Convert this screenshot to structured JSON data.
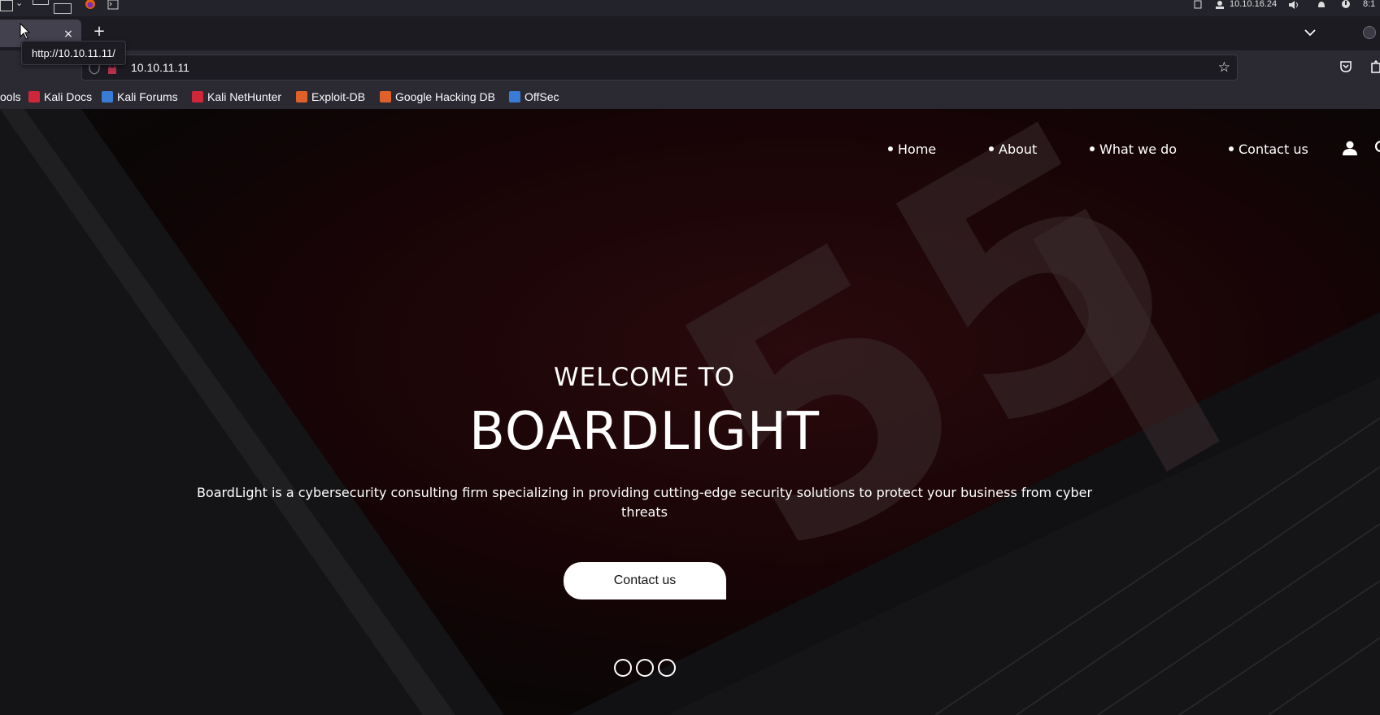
{
  "os": {
    "ip": "10.10.16.24",
    "clock": "8:1"
  },
  "browser": {
    "new_tab_label": "+",
    "tab_close_label": "×",
    "url": "10.10.11.11",
    "hover_url": "http://10.10.11.11/",
    "bookmark_star": "☆"
  },
  "bookmarks": [
    {
      "label": "ools",
      "color": "#2b2a33"
    },
    {
      "label": "Kali Docs",
      "color": "#d0263a"
    },
    {
      "label": "Kali Forums",
      "color": "#3a7bd5"
    },
    {
      "label": "Kali NetHunter",
      "color": "#d0263a"
    },
    {
      "label": "Exploit-DB",
      "color": "#e0602a"
    },
    {
      "label": "Google Hacking DB",
      "color": "#e0602a"
    },
    {
      "label": "OffSec",
      "color": "#3a7bd5"
    }
  ],
  "site": {
    "nav": [
      {
        "label": "Home"
      },
      {
        "label": "About"
      },
      {
        "label": "What we do"
      },
      {
        "label": "Contact us"
      }
    ],
    "hero": {
      "welcome": "WELCOME TO",
      "brand": "BOARDLIGHT",
      "description": "BoardLight is a cybersecurity consulting firm specializing in providing cutting-edge security solutions to protect your business from cyber threats",
      "cta": "Contact us"
    },
    "background_text": "55"
  }
}
